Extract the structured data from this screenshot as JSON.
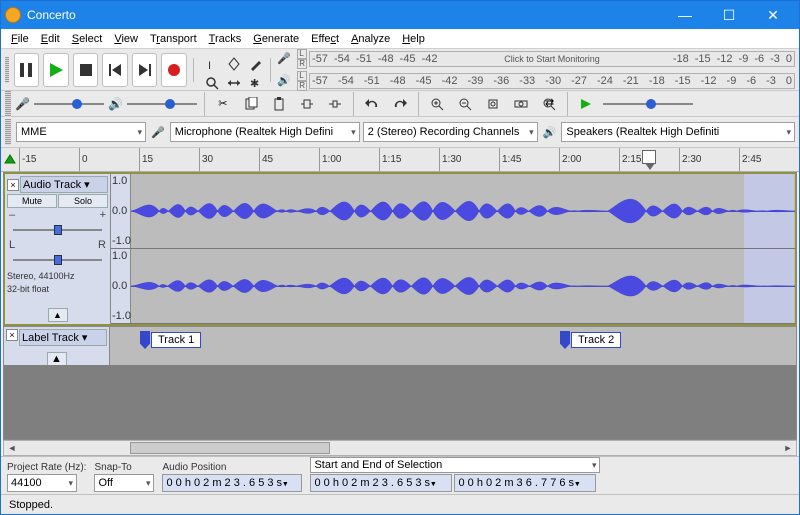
{
  "window": {
    "title": "Concerto"
  },
  "menu": [
    "File",
    "Edit",
    "Select",
    "View",
    "Transport",
    "Tracks",
    "Generate",
    "Effect",
    "Analyze",
    "Help"
  ],
  "meters": {
    "rec_ticks": [
      "-57",
      "-54",
      "-51",
      "-48",
      "-45",
      "-42"
    ],
    "rec_center": "Click to Start Monitoring",
    "rec_ticks2": [
      "-18",
      "-15",
      "-12",
      "-9",
      "-6",
      "-3",
      "0"
    ],
    "play_ticks": [
      "-57",
      "-54",
      "-51",
      "-48",
      "-45",
      "-42",
      "-39",
      "-36",
      "-33",
      "-30",
      "-27",
      "-24",
      "-21",
      "-18",
      "-15",
      "-12",
      "-9",
      "-6",
      "-3",
      "0"
    ]
  },
  "device": {
    "host": "MME",
    "input": "Microphone (Realtek High Defini",
    "channels": "2 (Stereo) Recording Channels",
    "output": "Speakers (Realtek High Definiti"
  },
  "ruler": {
    "marks": [
      "-15",
      "0",
      "15",
      "30",
      "45",
      "1:00",
      "1:15",
      "1:30",
      "1:45",
      "2:00",
      "2:15",
      "2:30",
      "2:45"
    ]
  },
  "track": {
    "name": "Audio Track",
    "mute": "Mute",
    "solo": "Solo",
    "pan_left": "L",
    "pan_right": "R",
    "info1": "Stereo, 44100Hz",
    "info2": "32-bit float",
    "scale_top": "1.0",
    "scale_mid": "0.0",
    "scale_bot": "-1.0"
  },
  "label_track": {
    "name": "Label Track",
    "labels": [
      "Track 1",
      "Track 2"
    ]
  },
  "selection": {
    "rate_label": "Project Rate (Hz):",
    "rate": "44100",
    "snap_label": "Snap-To",
    "snap": "Off",
    "pos_label": "Audio Position",
    "pos": "0 0 h 0 2 m 2 3 . 6 5 3 s",
    "range_label": "Start and End of Selection",
    "start": "0 0 h 0 2 m 2 3 . 6 5 3 s",
    "end": "0 0 h 0 2 m 3 6 . 7 7 6 s"
  },
  "status": "Stopped."
}
